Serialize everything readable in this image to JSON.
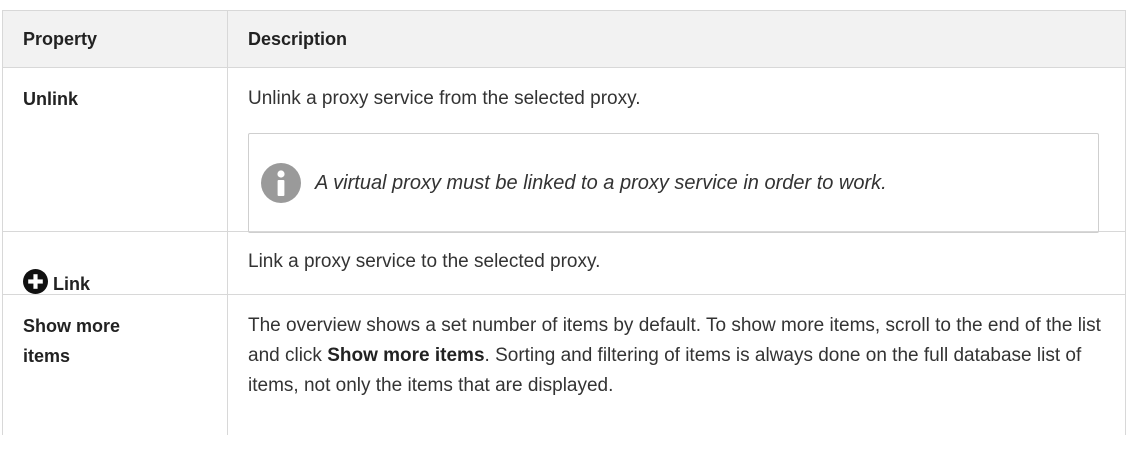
{
  "table": {
    "headers": {
      "property": "Property",
      "description": "Description"
    },
    "rows": [
      {
        "property": "Unlink",
        "description": "Unlink a proxy service from the selected proxy.",
        "note": {
          "icon": "info-icon",
          "text": "A virtual proxy must be linked to a proxy service in order to work."
        }
      },
      {
        "property": "Link",
        "icon": "plus-circle-icon",
        "description": "Link a proxy service to the selected proxy."
      },
      {
        "property": "Show more items",
        "description_part1": "The overview shows a set number of items by default. To show more items, scroll to the end of the list and click ",
        "description_bold": "Show more items",
        "description_part2": ". Sorting and filtering of items is always done on the full database list of items, not only the items that are displayed."
      }
    ]
  },
  "colors": {
    "border": "#d8d8d8",
    "header_bg": "#f2f2f2",
    "icon": "#9a9a9a",
    "text": "#333333"
  }
}
